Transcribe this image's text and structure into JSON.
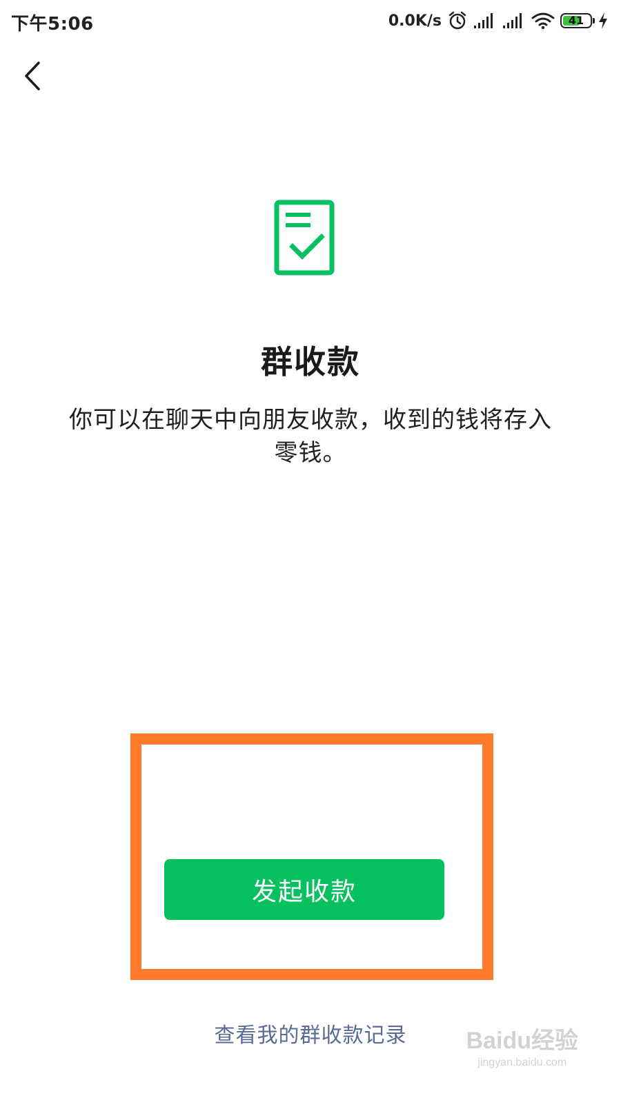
{
  "status_bar": {
    "time": "下午5:06",
    "net_speed": "0.0K/s",
    "battery_level": "41",
    "icons": [
      "alarm-icon",
      "signal-icon",
      "signal-icon",
      "wifi-icon",
      "battery-icon",
      "charging-icon"
    ]
  },
  "nav": {
    "back_icon": "chevron-left-icon"
  },
  "main": {
    "hero_icon": "document-check-icon",
    "title": "群收款",
    "description": "你可以在聊天中向朋友收款，收到的钱将存入零钱。",
    "primary_button_label": "发起收款",
    "records_link_label": "查看我的群收款记录"
  },
  "watermark": {
    "main": "Baidu经验",
    "sub": "jingyan.baidu.com"
  },
  "colors": {
    "accent_green": "#07c160",
    "highlight_orange": "#ff7a2b",
    "link_blue": "#576b95"
  }
}
